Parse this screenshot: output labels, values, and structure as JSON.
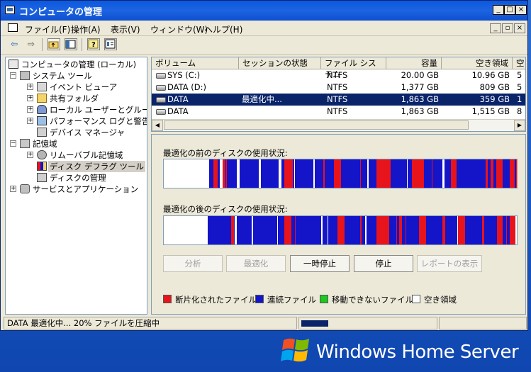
{
  "window": {
    "title": "コンピュータの管理",
    "controls": [
      "_",
      "□",
      "×"
    ]
  },
  "menubar": {
    "items": [
      "ファイル(F)",
      "操作(A)",
      "表示(V)",
      "ウィンドウ(W)",
      "ヘルプ(H)"
    ],
    "mdi_controls": [
      "_",
      "▫",
      "×"
    ]
  },
  "toolbar": {
    "buttons": [
      "back-icon",
      "forward-icon",
      "up-folder-icon",
      "show-tree-icon",
      "help-icon",
      "properties-icon"
    ]
  },
  "tree": {
    "root": "コンピュータの管理 (ローカル)",
    "system_tools": "システム ツール",
    "event_viewer": "イベント ビューア",
    "shared_folders": "共有フォルダ",
    "local_users": "ローカル ユーザーとグループ",
    "perf_logs": "パフォーマンス ログと警告",
    "device_manager": "デバイス マネージャ",
    "storage": "記憶域",
    "removable_storage": "リムーバブル記憶域",
    "disk_defrag": "ディスク デフラグ ツール",
    "disk_management": "ディスクの管理",
    "services_apps": "サービスとアプリケーション"
  },
  "volume_list": {
    "columns": [
      "ボリューム",
      "セッションの状態",
      "ファイル システム",
      "容量",
      "空き領域",
      "空"
    ],
    "rows": [
      {
        "volume": "SYS (C:)",
        "status": "",
        "fs": "NTFS",
        "capacity": "20.00 GB",
        "free": "10.96 GB",
        "pct": "5"
      },
      {
        "volume": "DATA (D:)",
        "status": "",
        "fs": "NTFS",
        "capacity": "1,377 GB",
        "free": "809 GB",
        "pct": "5"
      },
      {
        "volume": "DATA",
        "status": "最適化中...",
        "fs": "NTFS",
        "capacity": "1,863 GB",
        "free": "359 GB",
        "pct": "1"
      },
      {
        "volume": "DATA",
        "status": "",
        "fs": "NTFS",
        "capacity": "1,863 GB",
        "free": "1,515 GB",
        "pct": "8"
      }
    ],
    "selected_row": 2
  },
  "defrag": {
    "before_label": "最適化の前のディスクの使用状況:",
    "after_label": "最適化の後のディスクの使用状況:",
    "buttons": {
      "analyze": "分析",
      "defragment": "最適化",
      "pause": "一時停止",
      "stop": "停止",
      "report": "レポートの表示"
    },
    "legend": {
      "fragmented": "断片化されたファイル",
      "contiguous": "連続ファイル",
      "unmovable": "移動できないファイル",
      "free": "空き領域"
    },
    "colors": {
      "fragmented": "#e8141b",
      "contiguous": "#1414c8",
      "unmovable": "#1ec81e",
      "free": "#ffffff"
    }
  },
  "status": {
    "text": "DATA 最適化中... 20% ファイルを圧縮中",
    "progress_fraction": 0.2
  },
  "brand": {
    "text": "Windows Home Server"
  }
}
